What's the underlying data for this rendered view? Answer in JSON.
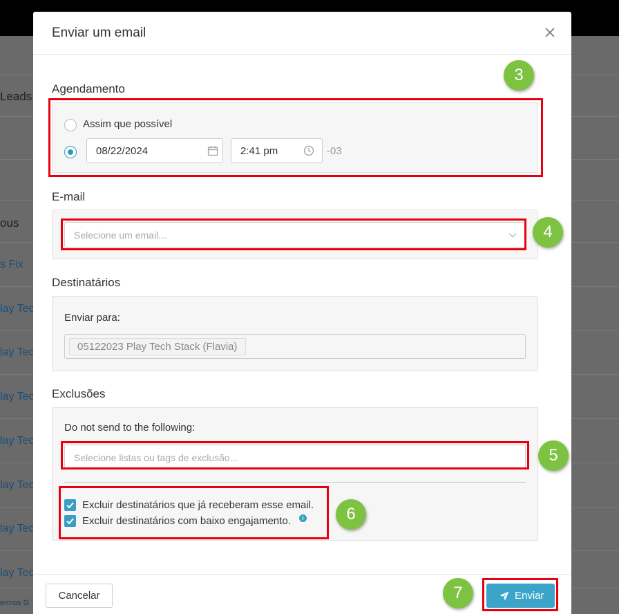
{
  "background": {
    "rows": [
      "Leads",
      "ous",
      "s Fix",
      "lay Tec",
      "lay Tec",
      "lay Tec",
      "lay Tec",
      "lay Tec",
      "lay Tec",
      "lay Tec"
    ],
    "footer_text": "ermos G"
  },
  "modal": {
    "title": "Enviar um email",
    "scheduling": {
      "title": "Agendamento",
      "option_asap": "Assim que possível",
      "date_value": "08/22/2024",
      "time_value": "2:41 pm",
      "timezone": "-03",
      "selected": "scheduled"
    },
    "email": {
      "title": "E-mail",
      "placeholder": "Selecione um email..."
    },
    "recipients": {
      "title": "Destinatários",
      "send_to_label": "Enviar para:",
      "tags": [
        "05122023 Play Tech Stack (Flavia)"
      ]
    },
    "exclusions": {
      "title": "Exclusões",
      "do_not_send_label": "Do not send to the following:",
      "placeholder": "Selecione listas ou tags de exclusão...",
      "exclude_already_received": "Excluir destinatários que já receberam esse email.",
      "exclude_low_engagement": "Excluir destinatários com baixo engajamento.",
      "exclude_already_received_checked": true,
      "exclude_low_engagement_checked": true
    },
    "footer": {
      "cancel_label": "Cancelar",
      "send_label": "Enviar"
    }
  },
  "annotations": {
    "step_3": "3",
    "step_4": "4",
    "step_5": "5",
    "step_6": "6",
    "step_7": "7",
    "highlight_color": "#e8000e",
    "badge_color": "#7dc241"
  },
  "colors": {
    "accent": "#3aa5c8",
    "overlay": "#6a6a6a"
  }
}
